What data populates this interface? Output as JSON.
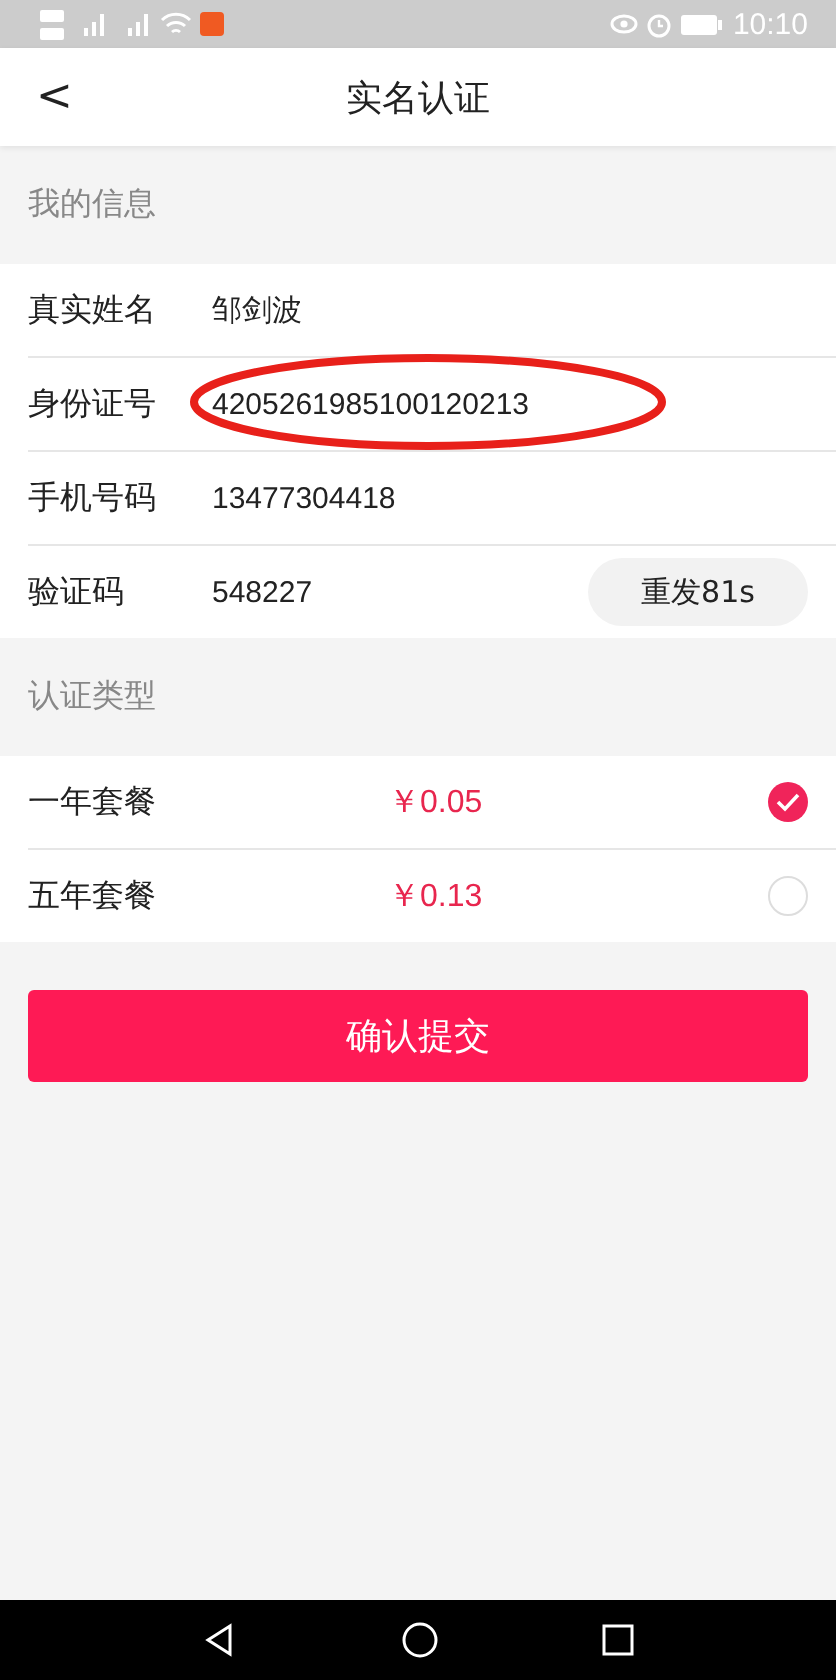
{
  "status_bar": {
    "time": "10:10"
  },
  "header": {
    "back": "<",
    "title": "实名认证"
  },
  "my_info": {
    "title": "我的信息",
    "fields": [
      {
        "label": "真实姓名",
        "value": "邹剑波"
      },
      {
        "label": "身份证号",
        "value": "4205261985100120213",
        "highlighted": true
      },
      {
        "label": "手机号码",
        "value": "13477304418"
      },
      {
        "label": "验证码",
        "value": "548227",
        "action": "重发81s"
      }
    ]
  },
  "cert_type": {
    "title": "认证类型",
    "plans": [
      {
        "name": "一年套餐",
        "price": "￥0.05",
        "selected": true
      },
      {
        "name": "五年套餐",
        "price": "￥0.13",
        "selected": false
      }
    ]
  },
  "submit": "确认提交"
}
